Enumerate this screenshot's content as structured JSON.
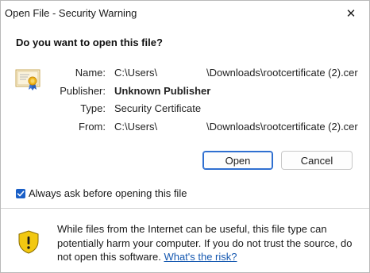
{
  "window": {
    "title": "Open File - Security Warning",
    "close_glyph": "✕"
  },
  "question": "Do you want to open this file?",
  "file_info": {
    "name_label": "Name:",
    "name_value_start": "C:\\Users\\",
    "name_value_end": "\\Downloads\\rootcertificate (2).cer",
    "publisher_label": "Publisher:",
    "publisher_value": "Unknown Publisher",
    "type_label": "Type:",
    "type_value": "Security Certificate",
    "from_label": "From:",
    "from_value_start": "C:\\Users\\",
    "from_value_end": "\\Downloads\\rootcertificate (2).cer"
  },
  "buttons": {
    "open_label": "Open",
    "cancel_label": "Cancel"
  },
  "checkbox": {
    "label": "Always ask before opening this file",
    "checked": true
  },
  "warning": {
    "text": "While files from the Internet can be useful, this file type can potentially harm your computer. If you do not trust the source, do not open this software.",
    "link_text": "What's the risk?"
  },
  "colors": {
    "accent": "#1a5fc7",
    "link": "#1558b0",
    "shield_yellow": "#f2c811"
  },
  "icons": {
    "file_icon": "certificate-icon",
    "warning_icon": "shield-warning-icon",
    "close_icon": "close-icon",
    "check_icon": "checkmark-icon"
  }
}
